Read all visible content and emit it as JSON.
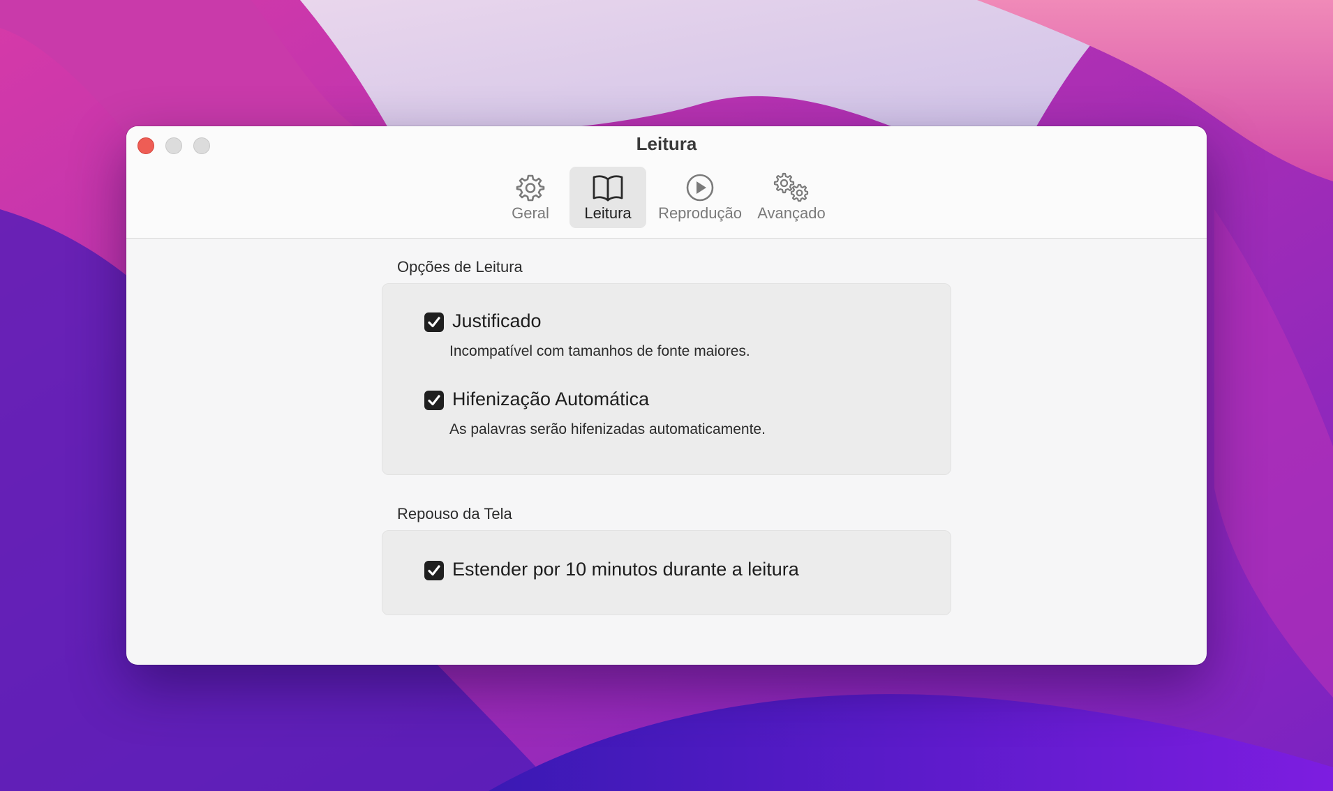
{
  "window": {
    "title": "Leitura"
  },
  "toolbar": {
    "tabs": [
      {
        "label": "Geral",
        "icon": "gear-icon",
        "selected": false
      },
      {
        "label": "Leitura",
        "icon": "book-icon",
        "selected": true
      },
      {
        "label": "Reprodução",
        "icon": "play-circle-icon",
        "selected": false
      },
      {
        "label": "Avançado",
        "icon": "gears-icon",
        "selected": false
      }
    ]
  },
  "sections": [
    {
      "title": "Opções de Leitura",
      "options": [
        {
          "label": "Justificado",
          "description": "Incompatível com tamanhos de fonte maiores.",
          "checked": true
        },
        {
          "label": "Hifenização Automática",
          "description": "As palavras serão hifenizadas automaticamente.",
          "checked": true
        }
      ]
    },
    {
      "title": "Repouso da Tela",
      "options": [
        {
          "label": "Estender por 10 minutos durante a leitura",
          "checked": true
        }
      ]
    }
  ],
  "colors": {
    "close_button": "#ee5d55",
    "checkbox_fill": "#1f1f1f",
    "selected_tab_bg": "#e6e6e6"
  }
}
